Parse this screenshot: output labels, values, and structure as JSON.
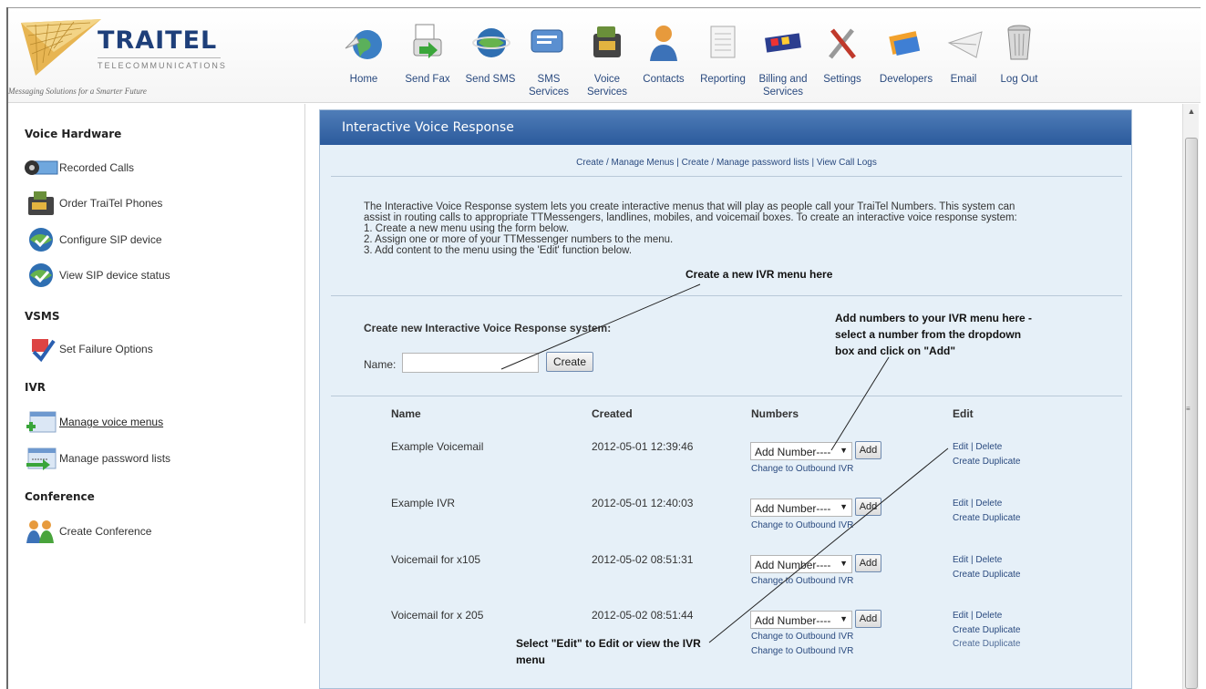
{
  "header": {
    "logo_name": "TRAITEL",
    "logo_sub": "TELECOMMUNICATIONS",
    "tagline": "Messaging Solutions for a Smarter Future",
    "nav": [
      {
        "label": "Home",
        "icon": "globe-icon"
      },
      {
        "label": "Send Fax",
        "icon": "fax-icon"
      },
      {
        "label": "Send SMS",
        "icon": "sms-globe-icon"
      },
      {
        "label": "SMS\nServices",
        "icon": "sms-services-icon"
      },
      {
        "label": "Voice\nServices",
        "icon": "voice-services-icon"
      },
      {
        "label": "Contacts",
        "icon": "contacts-icon"
      },
      {
        "label": "Reporting",
        "icon": "report-icon"
      },
      {
        "label": "Billing and\nServices",
        "icon": "billing-icon"
      },
      {
        "label": "Settings",
        "icon": "tools-icon"
      },
      {
        "label": "Developers",
        "icon": "developers-icon"
      },
      {
        "label": "Email",
        "icon": "email-icon"
      },
      {
        "label": "Log Out",
        "icon": "trash-icon"
      }
    ]
  },
  "sidebar": {
    "sections": [
      {
        "title": "Voice Hardware"
      },
      {
        "title": "VSMS"
      },
      {
        "title": "IVR"
      },
      {
        "title": "Conference"
      }
    ],
    "items": [
      {
        "label": "Recorded Calls",
        "icon": "recorded-calls-icon"
      },
      {
        "label": "Order TraiTel Phones",
        "icon": "phone-order-icon"
      },
      {
        "label": "Configure SIP device",
        "icon": "sip-config-icon"
      },
      {
        "label": "View SIP device status",
        "icon": "sip-status-icon"
      },
      {
        "label": "Set Failure Options",
        "icon": "failure-options-icon"
      },
      {
        "label": "Manage voice menus",
        "icon": "voice-menu-icon"
      },
      {
        "label": "Manage password lists",
        "icon": "password-list-icon"
      },
      {
        "label": "Create Conference",
        "icon": "conference-icon"
      }
    ]
  },
  "panel": {
    "title": "Interactive Voice Response",
    "links": [
      "Create / Manage Menus",
      "Create / Manage password lists",
      "View Call Logs"
    ],
    "link_sep": "|",
    "intro": [
      "The Interactive Voice Response system lets you create interactive menus that will play as people call your TraiTel Numbers. This system can",
      "assist in routing calls to appropriate TTMessengers, landlines, mobiles, and voicemail boxes. To create an interactive voice response system:",
      "1. Create a new menu using the form below.",
      "2. Assign one or more of your TTMessenger numbers to the menu.",
      "3. Add content to the menu using the 'Edit' function below."
    ],
    "form_title": "Create new Interactive Voice Response system:",
    "name_label": "Name:",
    "name_value": "",
    "create_label": "Create",
    "columns": [
      "Name",
      "Created",
      "Numbers",
      "Edit"
    ],
    "rows": [
      {
        "name": "Example Voicemail",
        "created": "2012-05-01 12:39:46",
        "select": "Add Number----",
        "add": "Add",
        "outbound": [
          "Change to Outbound IVR"
        ],
        "edit": "Edit",
        "delete": "Delete",
        "duplicate": [
          "Create Duplicate"
        ]
      },
      {
        "name": "Example IVR",
        "created": "2012-05-01 12:40:03",
        "select": "Add Number----",
        "add": "Add",
        "outbound": [
          "Change to Outbound IVR"
        ],
        "edit": "Edit",
        "delete": "Delete",
        "duplicate": [
          "Create Duplicate"
        ]
      },
      {
        "name": "Voicemail for x105",
        "created": "2012-05-02 08:51:31",
        "select": "Add Number----",
        "add": "Add",
        "outbound": [
          "Change to Outbound IVR"
        ],
        "edit": "Edit",
        "delete": "Delete",
        "duplicate": [
          "Create Duplicate"
        ]
      },
      {
        "name": "Voicemail for x 205",
        "created": "2012-05-02 08:51:44",
        "select": "Add Number----",
        "add": "Add",
        "outbound": [
          "Change to Outbound IVR",
          "Change to Outbound IVR"
        ],
        "edit": "Edit",
        "delete": "Delete",
        "duplicate": [
          "Create Duplicate",
          "Create Duplicate"
        ]
      }
    ]
  },
  "annotations": {
    "create_menu": "Create a new IVR menu here",
    "add_numbers": [
      "Add numbers to your IVR menu here -",
      "select a number from the dropdown",
      "box and click on \"Add\""
    ],
    "edit_menu": [
      "Select \"Edit\" to Edit or view the IVR",
      "menu"
    ]
  },
  "colors": {
    "header_blue": "#2b5a9c",
    "panel_bg": "#e6f0f8",
    "link": "#2a4a7f"
  }
}
